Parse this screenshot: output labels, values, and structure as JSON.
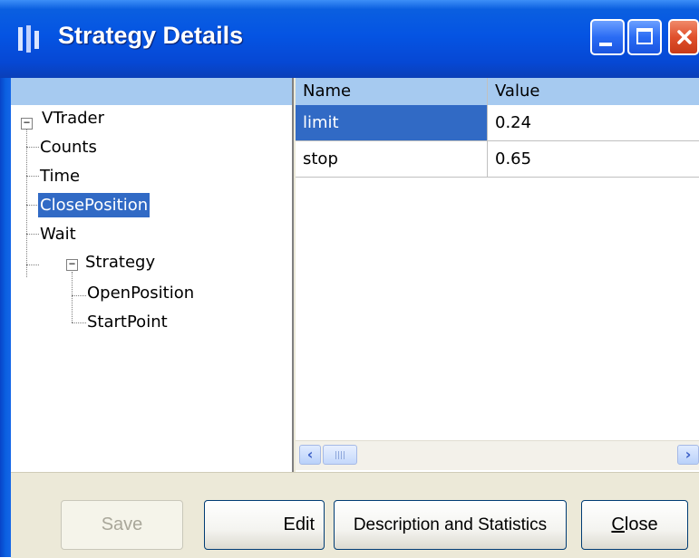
{
  "window": {
    "title": "Strategy Details"
  },
  "tree": {
    "root": "VTrader",
    "items": [
      "Counts",
      "Time",
      "ClosePosition",
      "Wait"
    ],
    "group": "Strategy",
    "group_items": [
      "OpenPosition",
      "StartPoint"
    ],
    "selected": "ClosePosition"
  },
  "grid": {
    "columns": [
      "Name",
      "Value"
    ],
    "rows": [
      {
        "name": "limit",
        "value": "0.24"
      },
      {
        "name": "stop",
        "value": "0.65"
      }
    ]
  },
  "buttons": {
    "save": "Save",
    "edit": "Edit",
    "description": "Description and Statistics",
    "close_mnemonic": "C",
    "close_rest": "lose"
  },
  "colors": {
    "selection": "#316ac5",
    "header": "#a6caf0",
    "titlebar": "#0554e3"
  }
}
